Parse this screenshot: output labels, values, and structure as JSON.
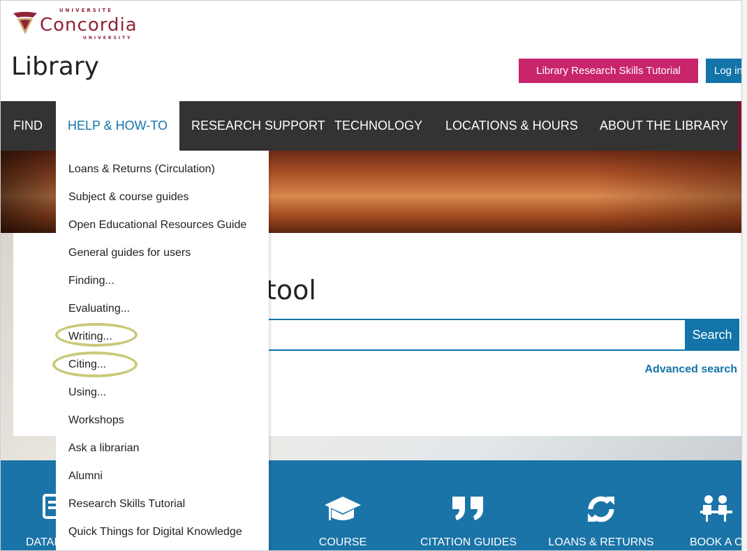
{
  "header": {
    "logo": {
      "top_text": "UNIVERSITÉ",
      "wordmark": "Concordia",
      "bottom_text": "UNIVERSITY"
    },
    "site_title": "Library",
    "tutorial_button": "Library Research Skills Tutorial",
    "login_button": "Log in"
  },
  "nav": {
    "items": [
      {
        "label": "FIND"
      },
      {
        "label": "HELP & HOW-TO",
        "active": true
      },
      {
        "label": "RESEARCH SUPPORT"
      },
      {
        "label": "TECHNOLOGY"
      },
      {
        "label": "LOCATIONS & HOURS"
      },
      {
        "label": "ABOUT THE LIBRARY"
      }
    ]
  },
  "dropdown": {
    "items": [
      {
        "label": "Loans & Returns (Circulation)"
      },
      {
        "label": "Subject & course guides"
      },
      {
        "label": "Open Educational Resources Guide"
      },
      {
        "label": "General guides for users"
      },
      {
        "label": "Finding..."
      },
      {
        "label": "Evaluating..."
      },
      {
        "label": "Writing...",
        "highlighted": true
      },
      {
        "label": "Citing...",
        "highlighted": true
      },
      {
        "label": "Using..."
      },
      {
        "label": "Workshops"
      },
      {
        "label": "Ask a librarian"
      },
      {
        "label": "Alumni"
      },
      {
        "label": "Research Skills Tutorial"
      },
      {
        "label": "Quick Things for Digital Knowledge"
      }
    ]
  },
  "search": {
    "heading_fragment": "tool",
    "input_value": "",
    "button_label": "Search",
    "advanced_link": "Advanced search"
  },
  "quicklinks": {
    "items": [
      {
        "label": "DATAI",
        "icon": "database-icon"
      },
      {
        "label": "COURSE",
        "icon": "graduation-cap-icon"
      },
      {
        "label": "CITATION GUIDES",
        "icon": "quote-icon"
      },
      {
        "label": "LOANS & RETURNS",
        "icon": "refresh-icon"
      },
      {
        "label": "BOOK A C",
        "icon": "group-study-icon"
      }
    ]
  },
  "colors": {
    "brand": "#912338",
    "nav_bg": "#333333",
    "link_blue": "#1274a8",
    "tutorial_pink": "#c8256d",
    "band_blue": "#1a74a8",
    "highlight_ring": "#c9c97a"
  }
}
